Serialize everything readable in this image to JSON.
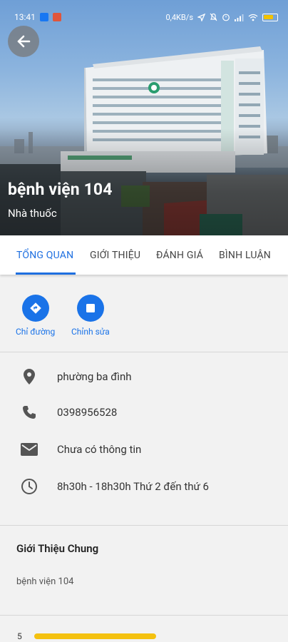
{
  "status_bar": {
    "time": "13:41",
    "network_speed": "0,4KB/s",
    "battery_level": "68"
  },
  "place": {
    "name": "bệnh viện 104",
    "category": "Nhà thuốc"
  },
  "tabs": [
    {
      "label": "TỔNG QUAN",
      "active": true
    },
    {
      "label": "GIỚI THIỆU",
      "active": false
    },
    {
      "label": "ĐÁNH GIÁ",
      "active": false
    },
    {
      "label": "BÌNH LUẬN",
      "active": false
    }
  ],
  "actions": [
    {
      "label": "Chỉ đường",
      "icon": "directions-icon"
    },
    {
      "label": "Chỉnh sửa",
      "icon": "stop-icon"
    }
  ],
  "info": {
    "address": "phường ba đình",
    "phone": "0398956528",
    "email": "Chưa có thông tin",
    "hours": "8h30h - 18h30h Thứ 2 đến thứ 6"
  },
  "intro": {
    "title": "Giới Thiệu Chung",
    "body": "bệnh viện 104"
  },
  "ratings": [
    {
      "stars": "5",
      "fraction": 0.54
    }
  ],
  "colors": {
    "accent": "#1a73e8",
    "rating_bar": "#f4c10f"
  }
}
